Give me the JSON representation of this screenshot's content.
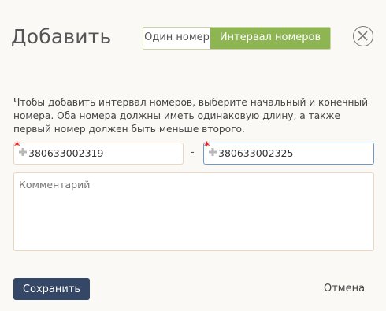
{
  "dialog": {
    "title": "Добавить",
    "mode_switch": {
      "single_label": "Один номер",
      "range_label": "Интервал номеров",
      "selected": "Интервал номеров"
    },
    "close_icon": "close-icon",
    "description": "Чтобы добавить интервал номеров, выберите начальный и конечный номера. Оба номера должны иметь одинаковую длину, а также первый номер должен быть меньше второго.",
    "range": {
      "start_value": "380633002319",
      "separator": "-",
      "end_value": "380633002325",
      "required_marker": "*",
      "prefix_icon": "plus-icon"
    },
    "comment": {
      "placeholder": "Комментарий",
      "value": ""
    },
    "save_label": "Сохранить",
    "cancel_label": "Отмена"
  },
  "colors": {
    "accent_green": "#8db551",
    "save_button": "#354766",
    "required": "#e02020",
    "focus_border": "#6f9ac8"
  }
}
